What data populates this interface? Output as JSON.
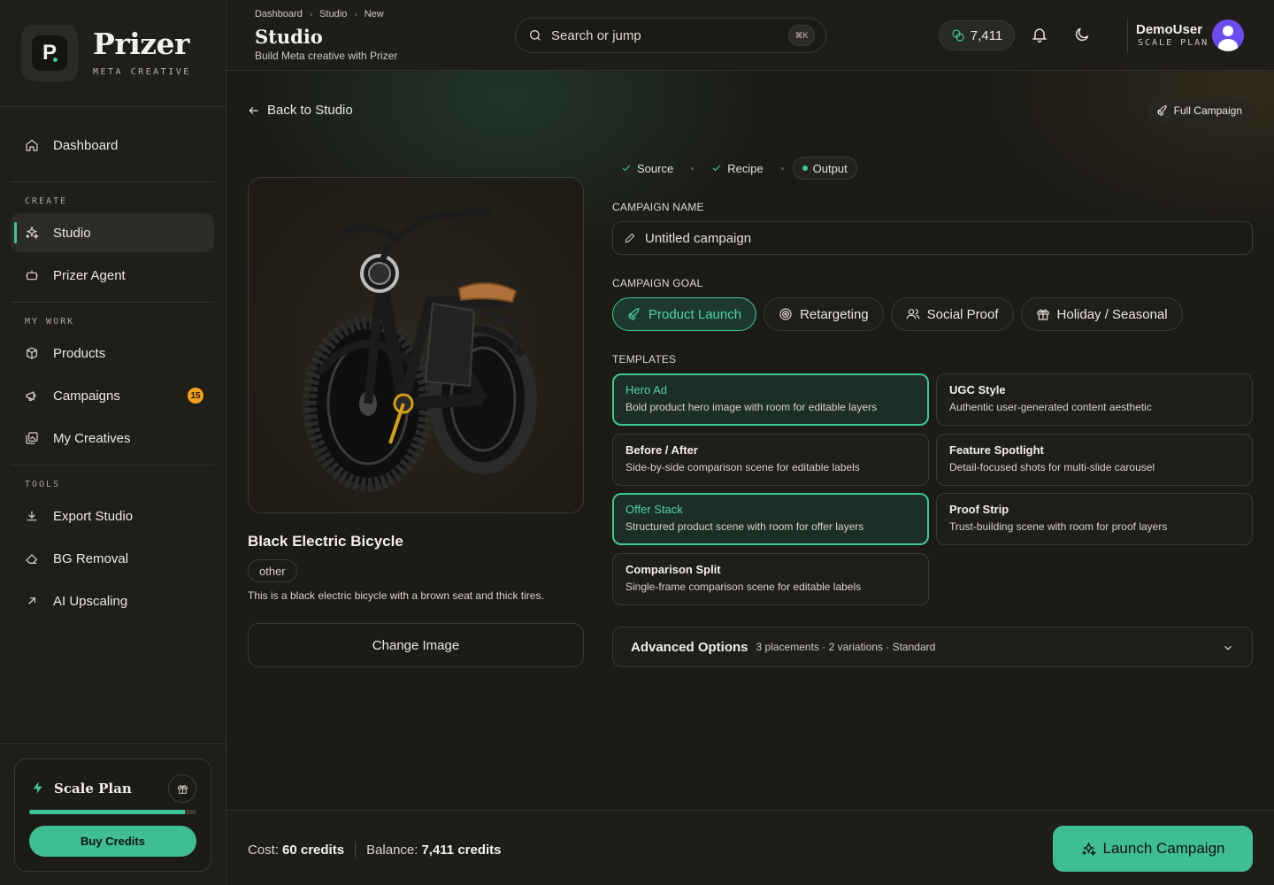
{
  "brand": {
    "name": "Prizer",
    "subtitle": "META CREATIVE",
    "logo_letter": "P"
  },
  "sidebar": {
    "dashboard": {
      "label": "Dashboard",
      "icon": "home-icon"
    },
    "sections": [
      {
        "label": "CREATE",
        "items": [
          {
            "label": "Studio",
            "icon": "sparkles-icon",
            "active": true
          },
          {
            "label": "Prizer Agent",
            "icon": "bot-icon"
          }
        ]
      },
      {
        "label": "MY WORK",
        "items": [
          {
            "label": "Products",
            "icon": "box-icon"
          },
          {
            "label": "Campaigns",
            "icon": "megaphone-icon",
            "badge": "15"
          },
          {
            "label": "My Creatives",
            "icon": "gallery-icon"
          }
        ]
      },
      {
        "label": "TOOLS",
        "items": [
          {
            "label": "Export Studio",
            "icon": "download-icon"
          },
          {
            "label": "BG Removal",
            "icon": "eraser-icon"
          },
          {
            "label": "AI Upscaling",
            "icon": "arrow-up-right-icon"
          }
        ]
      }
    ],
    "plan": {
      "name": "Scale Plan",
      "progress": 0.93,
      "buy_label": "Buy Credits"
    }
  },
  "header": {
    "breadcrumb": [
      "Dashboard",
      "Studio",
      "New"
    ],
    "title": "Studio",
    "subtitle": "Build Meta creative with Prizer",
    "search_placeholder": "Search or jump",
    "search_shortcut": "⌘K",
    "credits": "7,411",
    "user_name": "DemoUser",
    "user_plan": "SCALE PLAN"
  },
  "main": {
    "back_label": "Back to Studio",
    "full_campaign_label": "Full Campaign",
    "product": {
      "name": "Black Electric Bicycle",
      "tag": "other",
      "description": "This is a black electric bicycle with a brown seat and thick tires.",
      "change_label": "Change Image"
    },
    "steps": [
      {
        "label": "Source",
        "state": "done"
      },
      {
        "label": "Recipe",
        "state": "done"
      },
      {
        "label": "Output",
        "state": "current"
      }
    ],
    "campaign_name_label": "CAMPAIGN NAME",
    "campaign_name_value": "Untitled campaign",
    "campaign_goal_label": "CAMPAIGN GOAL",
    "goals": [
      {
        "label": "Product Launch",
        "icon": "rocket-icon",
        "active": true
      },
      {
        "label": "Retargeting",
        "icon": "target-icon"
      },
      {
        "label": "Social Proof",
        "icon": "users-icon"
      },
      {
        "label": "Holiday / Seasonal",
        "icon": "gift-icon"
      }
    ],
    "templates_label": "TEMPLATES",
    "templates": [
      {
        "title": "Hero Ad",
        "desc": "Bold product hero image with room for editable layers",
        "selected": true
      },
      {
        "title": "UGC Style",
        "desc": "Authentic user-generated content aesthetic"
      },
      {
        "title": "Before / After",
        "desc": "Side-by-side comparison scene for editable labels"
      },
      {
        "title": "Feature Spotlight",
        "desc": "Detail-focused shots for multi-slide carousel"
      },
      {
        "title": "Offer Stack",
        "desc": "Structured product scene with room for offer layers",
        "selected": true
      },
      {
        "title": "Proof Strip",
        "desc": "Trust-building scene with room for proof layers"
      },
      {
        "title": "Comparison Split",
        "desc": "Single-frame comparison scene for editable labels"
      }
    ],
    "advanced": {
      "title": "Advanced Options",
      "meta": "3 placements · 2 variations · Standard"
    }
  },
  "footer": {
    "cost_label": "Cost:",
    "cost_value": "60 credits",
    "balance_label": "Balance:",
    "balance_value": "7,411 credits",
    "launch_label": "Launch Campaign"
  },
  "colors": {
    "accent": "#3ec59a",
    "badge": "#f2a21b",
    "background": "#1c1b16",
    "avatar": "#6c4cf0"
  }
}
